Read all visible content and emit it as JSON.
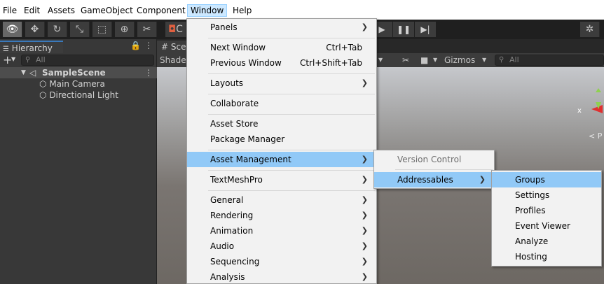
{
  "menubar": {
    "items": [
      "File",
      "Edit",
      "Assets",
      "GameObject",
      "Component",
      "Window",
      "Help"
    ]
  },
  "toolbar": {
    "scene_button_fragment": "C"
  },
  "hierarchy": {
    "tab_label": "Hierarchy",
    "search_placeholder": "All",
    "scene_name": "SampleScene",
    "children": [
      "Main Camera",
      "Directional Light"
    ]
  },
  "scene_view": {
    "tab_label": "Sce",
    "shading_label": "Shaded",
    "gizmos_label": "Gizmos",
    "search_placeholder": "All",
    "axis_x_label": "x",
    "persp_label": "P"
  },
  "window_menu": {
    "items": [
      {
        "label": "Panels",
        "submenu": true
      },
      {
        "label": "Next Window",
        "shortcut": "Ctrl+Tab"
      },
      {
        "label": "Previous Window",
        "shortcut": "Ctrl+Shift+Tab"
      },
      {
        "label": "Layouts",
        "submenu": true
      },
      {
        "label": "Collaborate"
      },
      {
        "label": "Asset Store"
      },
      {
        "label": "Package Manager"
      },
      {
        "label": "Asset Management",
        "submenu": true,
        "highlighted": true
      },
      {
        "label": "TextMeshPro",
        "submenu": true
      },
      {
        "label": "General",
        "submenu": true
      },
      {
        "label": "Rendering",
        "submenu": true
      },
      {
        "label": "Animation",
        "submenu": true
      },
      {
        "label": "Audio",
        "submenu": true
      },
      {
        "label": "Sequencing",
        "submenu": true
      },
      {
        "label": "Analysis",
        "submenu": true
      }
    ]
  },
  "asset_management_menu": {
    "items": [
      {
        "label": "Version Control",
        "disabled": true
      },
      {
        "label": "Addressables",
        "submenu": true,
        "highlighted": true
      }
    ]
  },
  "addressables_menu": {
    "items": [
      {
        "label": "Groups",
        "highlighted": true
      },
      {
        "label": "Settings"
      },
      {
        "label": "Profiles"
      },
      {
        "label": "Event Viewer"
      },
      {
        "label": "Analyze"
      },
      {
        "label": "Hosting"
      }
    ]
  },
  "colors": {
    "menu_highlight": "#91c9f7",
    "menubar_active": "#cce8ff",
    "editor_dark": "#383838"
  }
}
